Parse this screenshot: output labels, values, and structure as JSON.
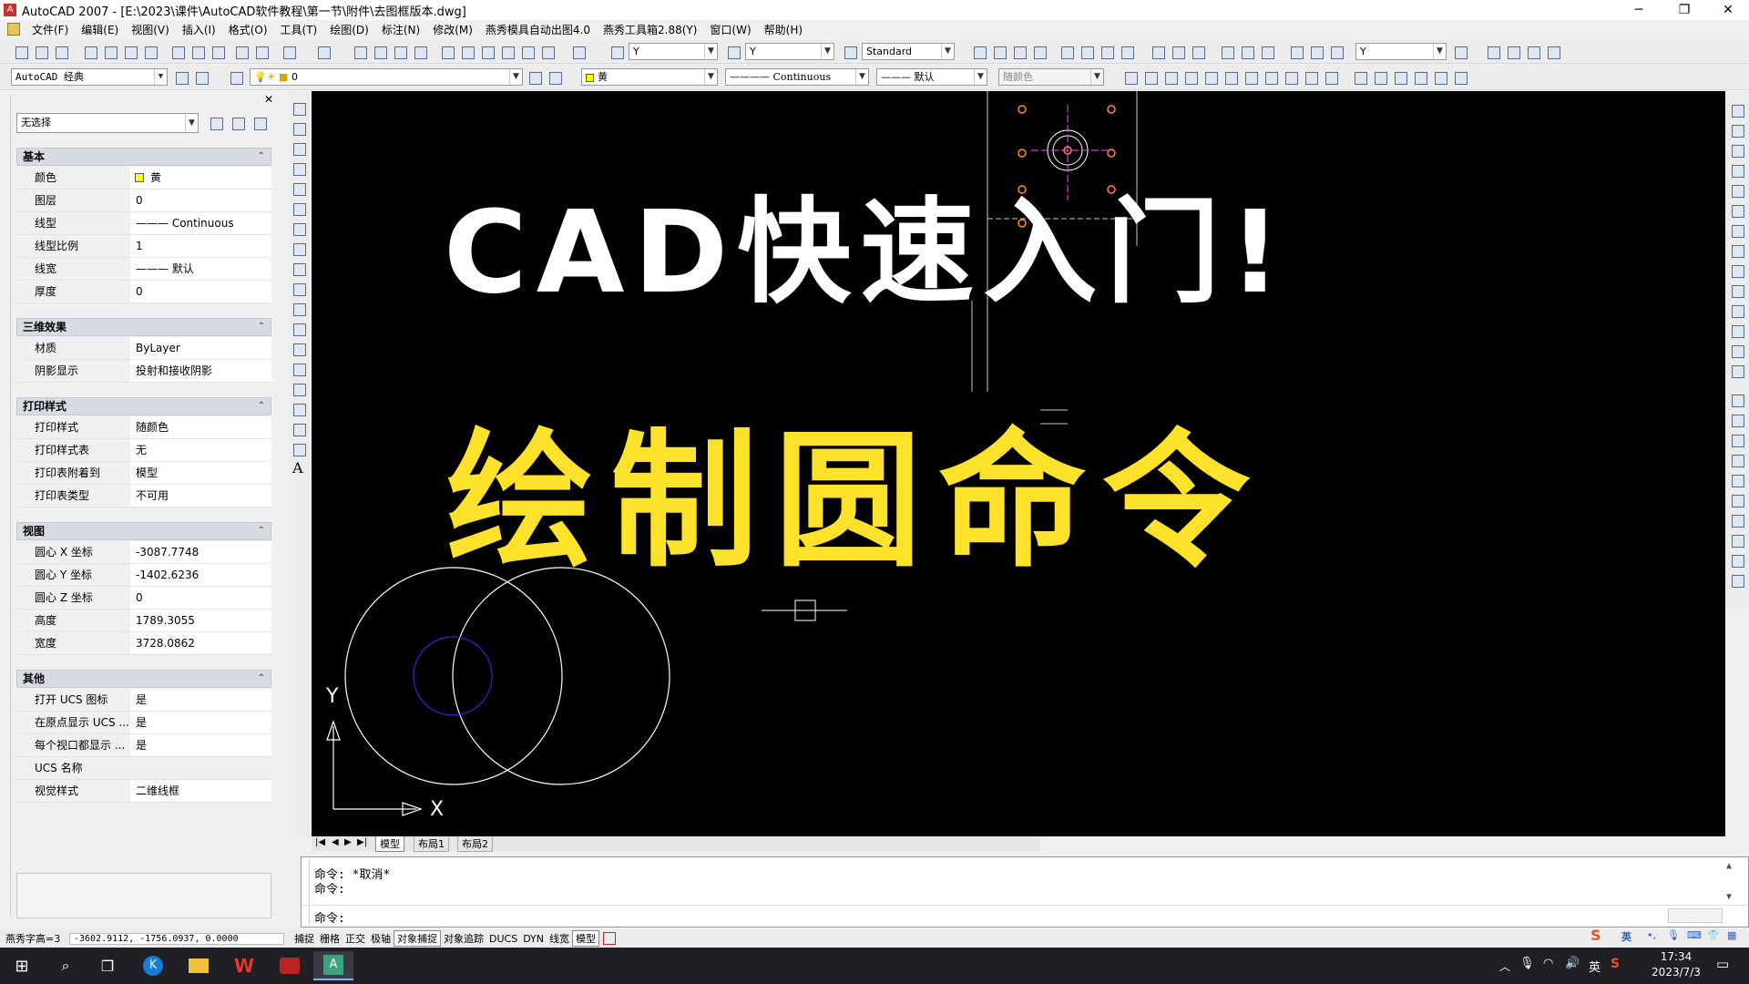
{
  "window": {
    "title": "AutoCAD 2007 - [E:\\2023\\课件\\AutoCAD软件教程\\第一节\\附件\\去图框版本.dwg]",
    "minimize": "─",
    "restore": "❐",
    "close": "✕"
  },
  "menu": {
    "items": [
      "文件(F)",
      "编辑(E)",
      "视图(V)",
      "插入(I)",
      "格式(O)",
      "工具(T)",
      "绘图(D)",
      "标注(N)",
      "修改(M)",
      "燕秀模具自动出图4.0",
      "燕秀工具箱2.88(Y)",
      "窗口(W)",
      "帮助(H)"
    ]
  },
  "toolbar": {
    "textstyle_value": "Y",
    "dimstyle_value": "Y",
    "tablestyle_value": "Standard",
    "mleader_value": "Y",
    "workspace_value": "AutoCAD 经典",
    "layer_value": "0",
    "color_value": "黄",
    "linetype_value": "Continuous",
    "lineweight_value": "默认",
    "plotstyle_value": "随颜色"
  },
  "properties": {
    "selection_value": "无选择",
    "sections": [
      {
        "title": "基本",
        "rows": [
          {
            "key": "颜色",
            "value": "黄"
          },
          {
            "key": "图层",
            "value": "0"
          },
          {
            "key": "线型",
            "value": "——— Continuous"
          },
          {
            "key": "线型比例",
            "value": "1"
          },
          {
            "key": "线宽",
            "value": "——— 默认"
          },
          {
            "key": "厚度",
            "value": "0"
          }
        ]
      },
      {
        "title": "三维效果",
        "rows": [
          {
            "key": "材质",
            "value": "ByLayer"
          },
          {
            "key": "阴影显示",
            "value": "投射和接收阴影"
          }
        ]
      },
      {
        "title": "打印样式",
        "rows": [
          {
            "key": "打印样式",
            "value": "随颜色"
          },
          {
            "key": "打印样式表",
            "value": "无"
          },
          {
            "key": "打印表附着到",
            "value": "模型"
          },
          {
            "key": "打印表类型",
            "value": "不可用"
          }
        ]
      },
      {
        "title": "视图",
        "rows": [
          {
            "key": "圆心 X 坐标",
            "value": "-3087.7748"
          },
          {
            "key": "圆心 Y 坐标",
            "value": "-1402.6236"
          },
          {
            "key": "圆心 Z 坐标",
            "value": "0"
          },
          {
            "key": "高度",
            "value": "1789.3055"
          },
          {
            "key": "宽度",
            "value": "3728.0862"
          }
        ]
      },
      {
        "title": "其他",
        "rows": [
          {
            "key": "打开 UCS 图标",
            "value": "是"
          },
          {
            "key": "在原点显示 UCS ...",
            "value": "是"
          },
          {
            "key": "每个视口都显示 ...",
            "value": "是"
          },
          {
            "key": "UCS 名称",
            "value": ""
          },
          {
            "key": "视觉样式",
            "value": "二维线框"
          }
        ]
      }
    ]
  },
  "canvas": {
    "headline": "CAD快速入门!",
    "subheadline": "绘制圆命令",
    "ucs_x": "X",
    "ucs_y": "Y",
    "colors": {
      "headline": "#ffffff",
      "subheadline": "#fce22a",
      "background": "#000000"
    }
  },
  "tabs": {
    "items": [
      "模型",
      "布局1",
      "布局2"
    ]
  },
  "command": {
    "lines": [
      "命令: *取消*",
      "命令:",
      "命令:"
    ]
  },
  "status": {
    "font_info": "燕秀字高=3",
    "coords": "-3602.9112, -1756.0937, 0.0000",
    "toggles": [
      "捕捉",
      "栅格",
      "正交",
      "极轴",
      "对象捕捉",
      "对象追踪",
      "DUCS",
      "DYN",
      "线宽",
      "模型"
    ]
  },
  "taskbar": {
    "time": "17:34",
    "date": "2023/7/3",
    "ime": "英",
    "lang": "英"
  }
}
